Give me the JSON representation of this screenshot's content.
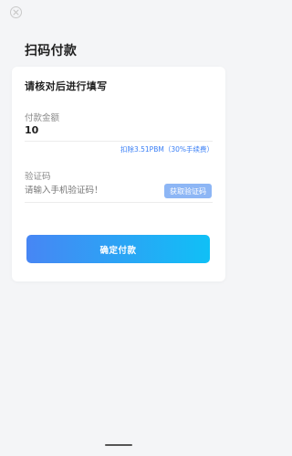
{
  "colors": {
    "accent_blue": "#3a7ff6",
    "button_gradient_start": "#4786f4",
    "button_gradient_end": "#10c0f6",
    "get_code_button": "#8db6f5",
    "background": "#f4f5f7",
    "card": "#ffffff"
  },
  "header": {
    "close_icon": "close-icon",
    "title": "扫码付款"
  },
  "card": {
    "title": "请核对后进行填写",
    "amount": {
      "label": "付款金额",
      "value": "10",
      "fee_note": "扣除3.51PBM（30%手续费）"
    },
    "verification": {
      "label": "验证码",
      "placeholder": "请输入手机验证码！",
      "get_code_label": "获取验证码"
    },
    "confirm_label": "确定付款"
  }
}
